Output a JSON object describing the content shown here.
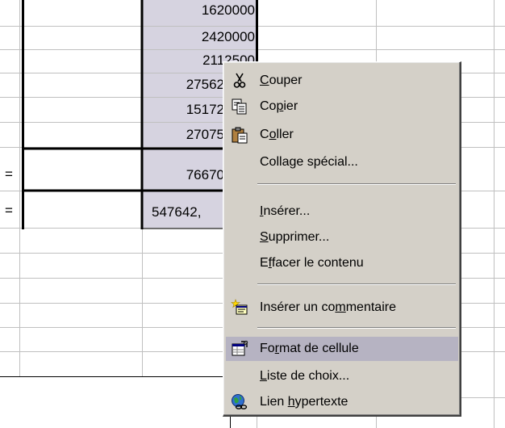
{
  "cells": {
    "values": [
      "1620000",
      "2420000",
      "2112500",
      "27562",
      "15172",
      "27075",
      "76670",
      "547642,"
    ],
    "eq_1": "=",
    "eq_2": "="
  },
  "context_menu": {
    "items": [
      {
        "name": "couper",
        "pre": "",
        "acc": "C",
        "post": "ouper",
        "icon": "scissors-icon"
      },
      {
        "name": "copier",
        "pre": "Co",
        "acc": "p",
        "post": "ier",
        "icon": "copy-icon"
      },
      {
        "name": "coller",
        "pre": "C",
        "acc": "o",
        "post": "ller",
        "icon": "paste-icon"
      },
      {
        "name": "collage-special",
        "pre": "Colla",
        "acc": "g",
        "post": "e spécial...",
        "icon": ""
      },
      {
        "name": "inserer",
        "pre": "",
        "acc": "I",
        "post": "nsérer...",
        "icon": ""
      },
      {
        "name": "supprimer",
        "pre": "",
        "acc": "S",
        "post": "upprimer...",
        "icon": ""
      },
      {
        "name": "effacer-contenu",
        "pre": "E",
        "acc": "f",
        "post": "facer le contenu",
        "icon": ""
      },
      {
        "name": "inserer-commentaire",
        "pre": "Insérer un co",
        "acc": "m",
        "post": "mentaire",
        "icon": "comment-icon"
      },
      {
        "name": "format-cellule",
        "pre": "Fo",
        "acc": "r",
        "post": "mat de cellule",
        "icon": "format-cell-icon"
      },
      {
        "name": "liste-choix",
        "pre": "",
        "acc": "L",
        "post": "iste de choix...",
        "icon": ""
      },
      {
        "name": "lien-hypertexte",
        "pre": "Lien ",
        "acc": "h",
        "post": "ypertexte",
        "icon": "hyperlink-icon"
      }
    ],
    "highlighted": "format-cellule"
  },
  "colors": {
    "menu_bg": "#d4d0c8",
    "highlight": "#b6b3c2",
    "selection_fill": "#d6d3e0",
    "gridline": "#c0c0c0"
  }
}
